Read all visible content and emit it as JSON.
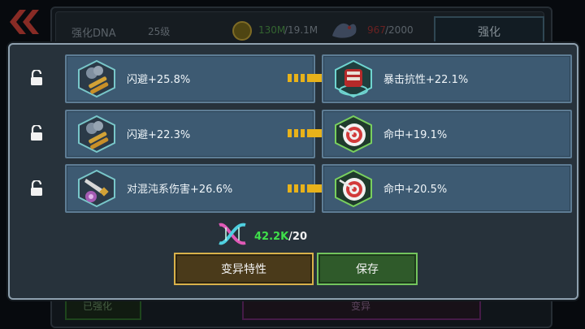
{
  "background": {
    "title": "强化DNA",
    "level": "25级",
    "gold_current": "130M",
    "gold_total": "/19.1M",
    "energy_current": "967",
    "energy_total": "/2000",
    "strengthen_button": "强化",
    "bottom_left_text": "已强化",
    "bottom_mid_text": "变异"
  },
  "traits": [
    {
      "current_label": "闪避+25.8%",
      "current_icon": "bullets-smoke-icon",
      "result_label": "暴击抗性+22.1%",
      "result_icon": "red-armor-icon"
    },
    {
      "current_label": "闪避+22.3%",
      "current_icon": "bullets-smoke-icon",
      "result_label": "命中+19.1%",
      "result_icon": "target-arrow-icon"
    },
    {
      "current_label": "对混沌系伤害+26.6%",
      "current_icon": "chaos-blade-icon",
      "result_label": "命中+20.5%",
      "result_icon": "target-arrow-icon"
    }
  ],
  "cost": {
    "have": "42.2K",
    "need": "/20",
    "have_color": "#3fe04a"
  },
  "buttons": {
    "mutate": "变异特性",
    "save": "保存"
  },
  "colors": {
    "accent_gold": "#d9b14a",
    "save_green": "#73c45d",
    "arrow_yellow": "#e8b21a"
  }
}
